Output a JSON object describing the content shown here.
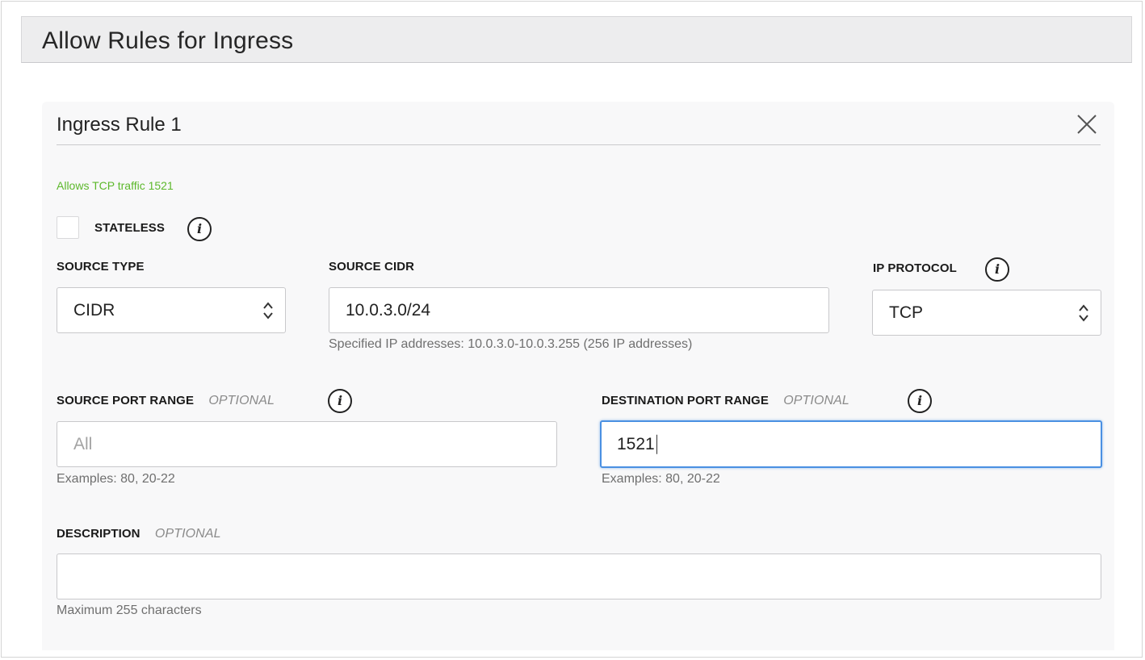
{
  "header": {
    "title": "Allow Rules for Ingress"
  },
  "rule": {
    "title": "Ingress Rule 1",
    "status": "Allows TCP traffic 1521",
    "stateless_label": "STATELESS",
    "stateless_checked": false
  },
  "source_type": {
    "label": "SOURCE TYPE",
    "value": "CIDR"
  },
  "source_cidr": {
    "label": "SOURCE CIDR",
    "value": "10.0.3.0/24",
    "hint": "Specified IP addresses: 10.0.3.0-10.0.3.255 (256 IP addresses)"
  },
  "ip_protocol": {
    "label": "IP PROTOCOL",
    "value": "TCP"
  },
  "source_port": {
    "label": "SOURCE PORT RANGE",
    "optional": "OPTIONAL",
    "placeholder": "All",
    "value": "",
    "hint": "Examples: 80, 20-22"
  },
  "destination_port": {
    "label": "DESTINATION PORT RANGE",
    "optional": "OPTIONAL",
    "value": "1521",
    "hint": "Examples: 80, 20-22"
  },
  "description": {
    "label": "DESCRIPTION",
    "optional": "OPTIONAL",
    "value": "",
    "hint": "Maximum 255 characters"
  },
  "icons": {
    "info": "i",
    "close": "close-icon",
    "select": "select-arrows-icon"
  },
  "colors": {
    "status_green": "#5cb82b",
    "focus_blue": "#4a90e2"
  }
}
